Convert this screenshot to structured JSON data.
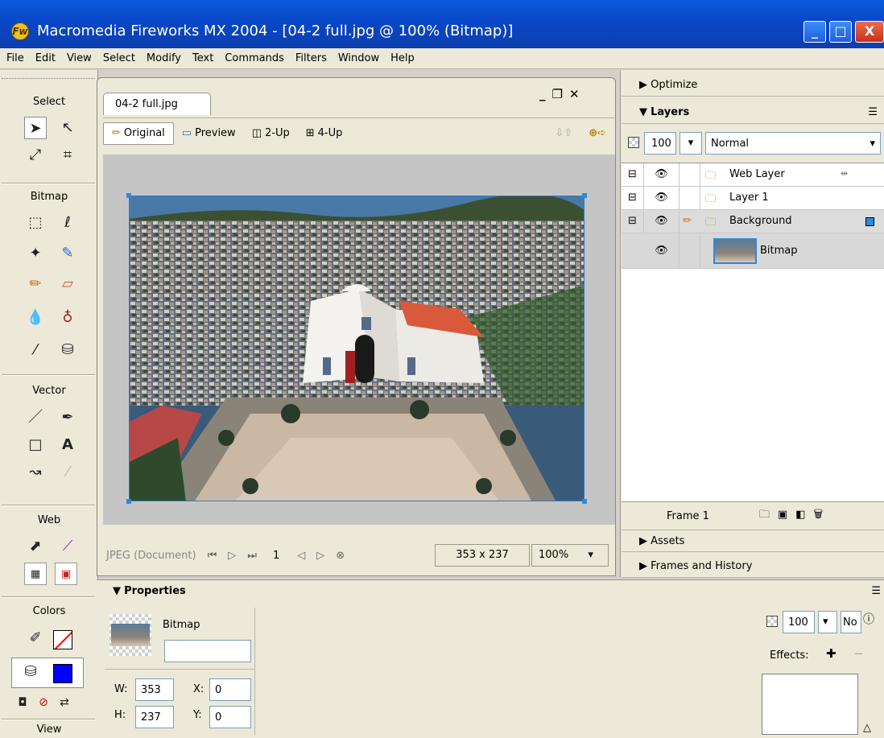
{
  "window": {
    "title": "Macromedia Fireworks MX 2004 - [04-2 full.jpg @ 100% (Bitmap)]",
    "minimize": "_",
    "maximize": "□",
    "close": "X"
  },
  "menu": [
    "File",
    "Edit",
    "View",
    "Select",
    "Modify",
    "Text",
    "Commands",
    "Filters",
    "Window",
    "Help"
  ],
  "tools": {
    "sections": {
      "select": "Select",
      "bitmap": "Bitmap",
      "vector": "Vector",
      "web": "Web",
      "colors": "Colors",
      "view": "View"
    },
    "stroke_color": "#ff0000",
    "fill_color": "#0000ff"
  },
  "document": {
    "tab": "04-2 full.jpg",
    "views": {
      "original": "Original",
      "preview": "Preview",
      "two_up": "2-Up",
      "four_up": "4-Up"
    },
    "status": {
      "format": "JPEG (Document)",
      "frame": "1",
      "size": "353 x 237",
      "zoom": "100%"
    }
  },
  "panels": {
    "optimize": "Optimize",
    "layers": "Layers",
    "opacity": "100",
    "blend_mode": "Normal",
    "layers_list": [
      "Web Layer",
      "Layer 1",
      "Background"
    ],
    "sublayer": "Bitmap",
    "frame": "Frame 1",
    "assets": "Assets",
    "frames_history": "Frames and History"
  },
  "properties": {
    "title": "Properties",
    "object_type": "Bitmap",
    "name_value": "",
    "w_label": "W:",
    "w": "353",
    "h_label": "H:",
    "h": "237",
    "x_label": "X:",
    "x": "0",
    "y_label": "Y:",
    "y": "0",
    "opacity": "100",
    "blend_partial": "No",
    "effects": "Effects:"
  }
}
